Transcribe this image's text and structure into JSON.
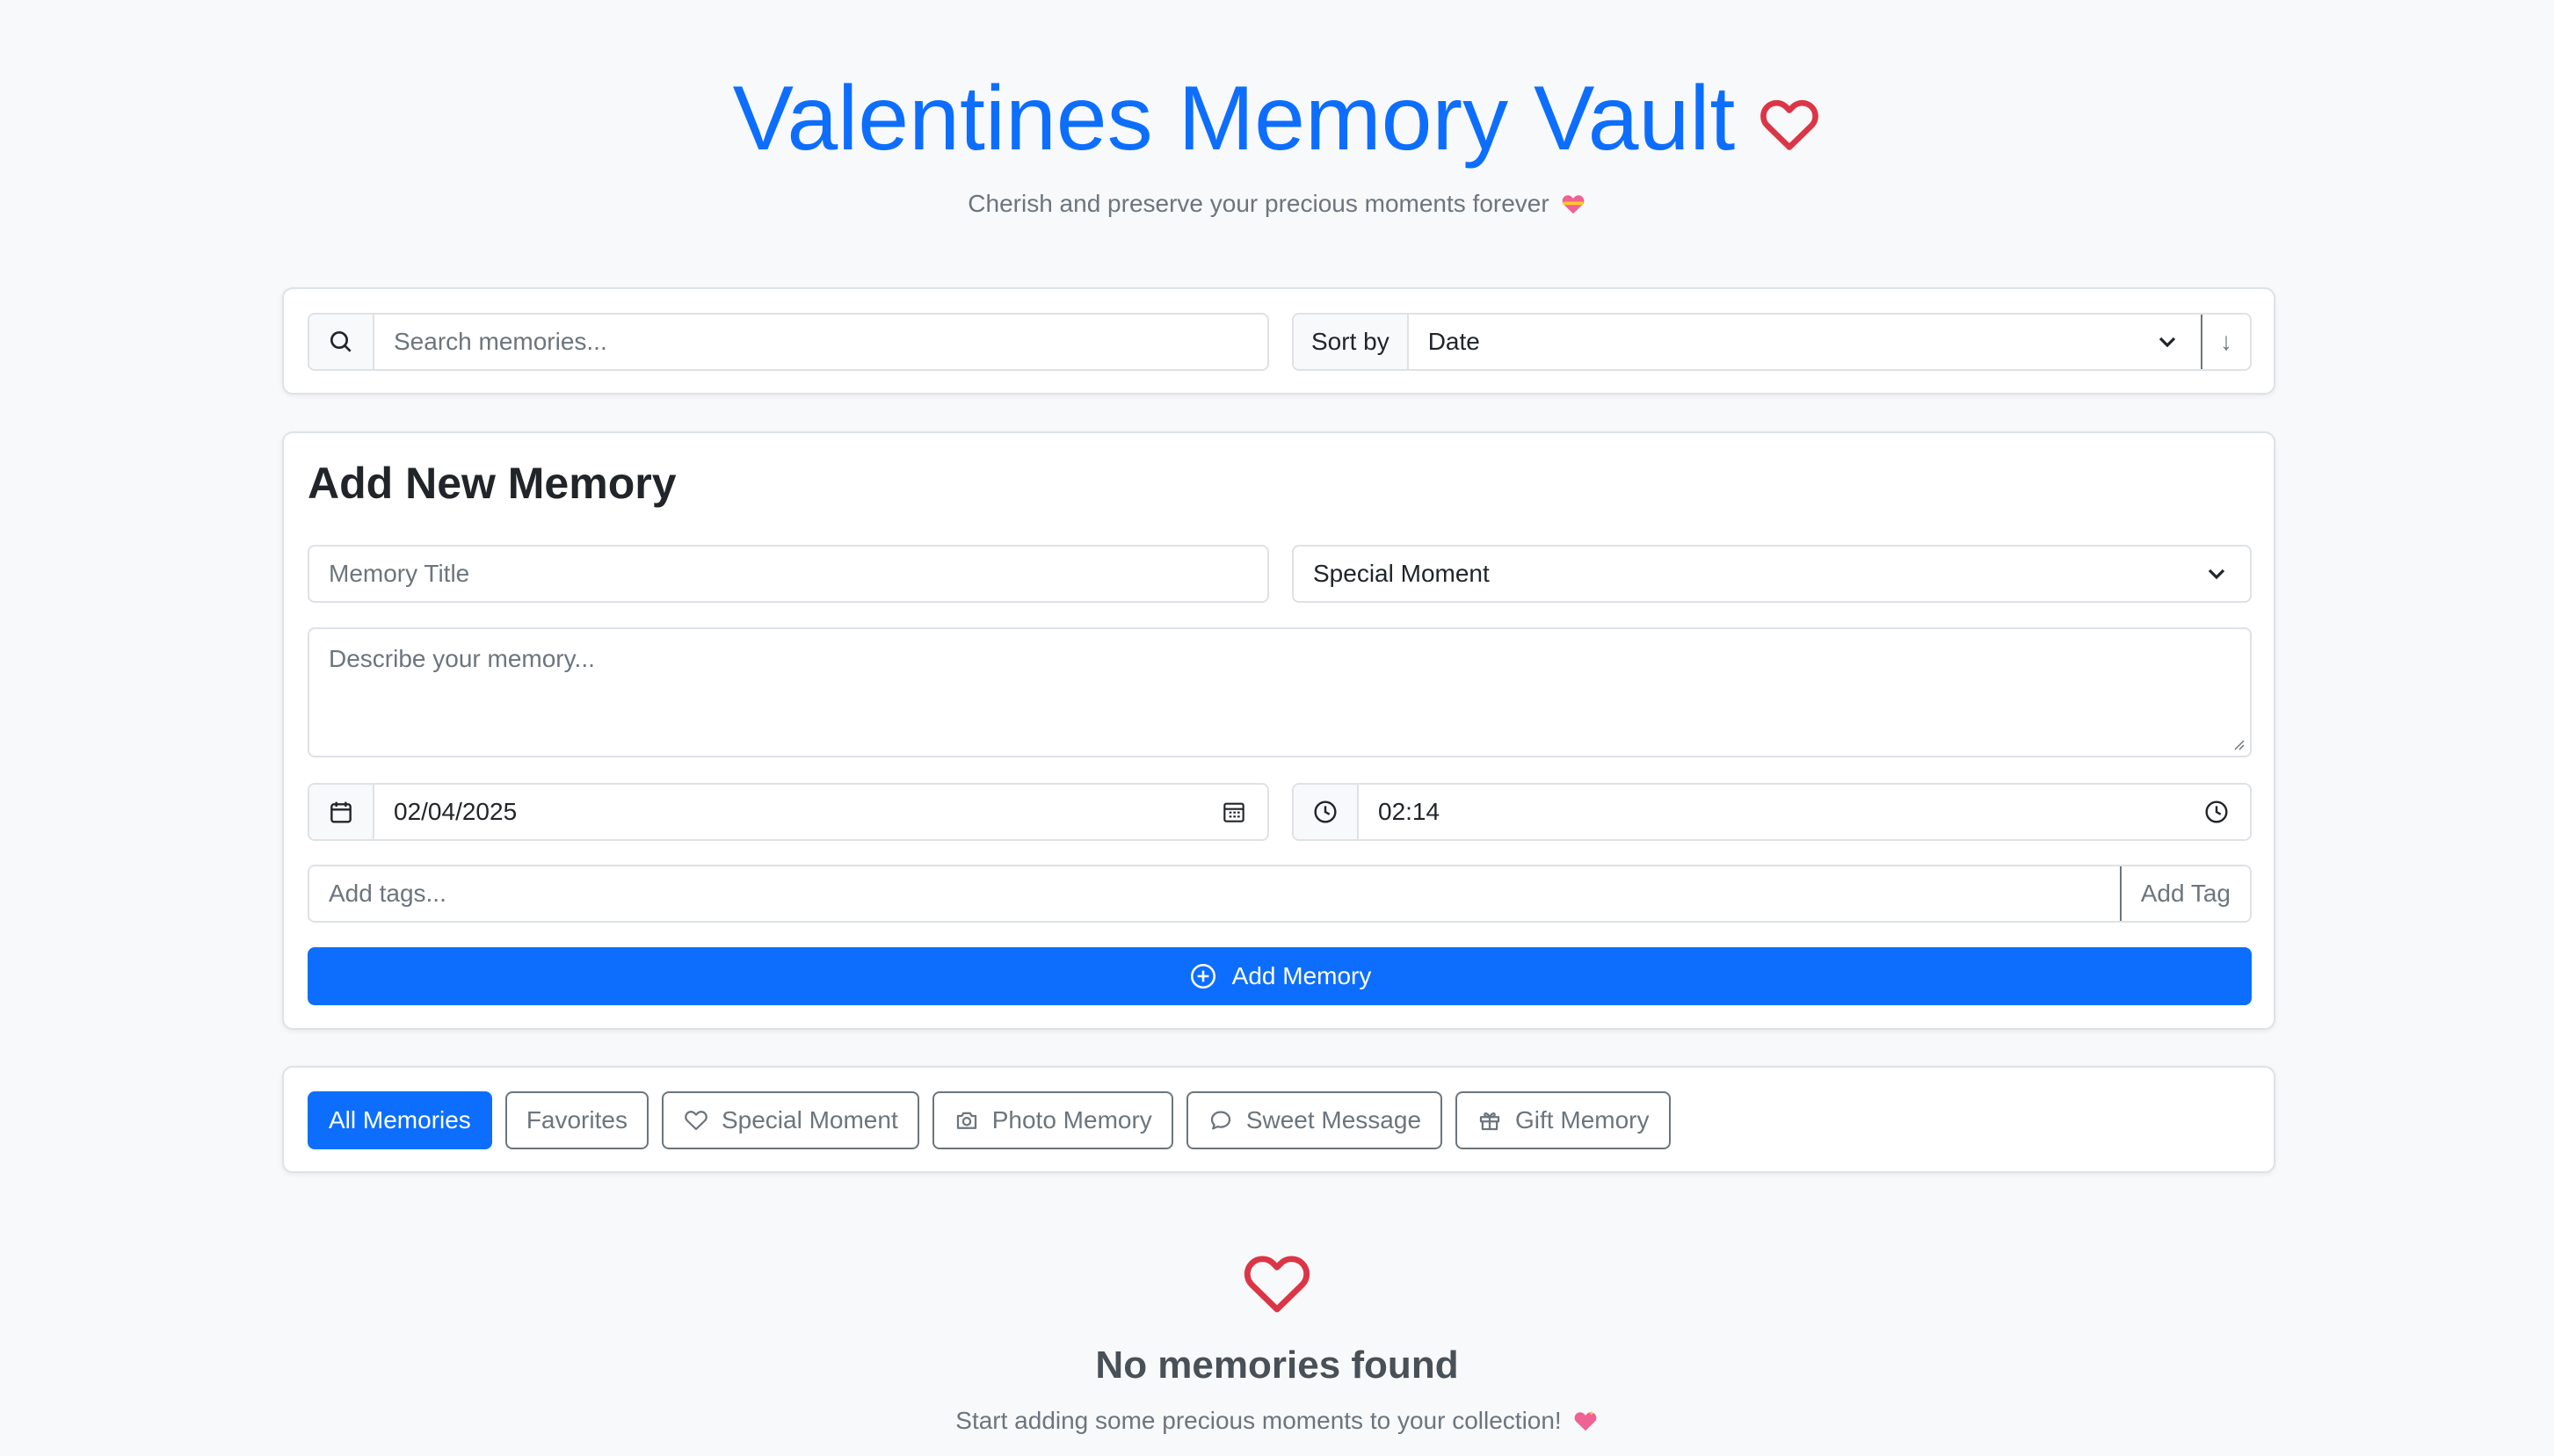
{
  "header": {
    "title": "Valentines Memory Vault",
    "subtitle": "Cherish and preserve your precious moments forever"
  },
  "toolbar": {
    "search_placeholder": "Search memories...",
    "sort_label": "Sort by",
    "sort_value": "Date",
    "sort_direction": "↓"
  },
  "form": {
    "heading": "Add New Memory",
    "title_placeholder": "Memory Title",
    "category_value": "Special Moment",
    "description_placeholder": "Describe your memory...",
    "date_value": "02/04/2025",
    "time_value": "02:14",
    "tags_placeholder": "Add tags...",
    "add_tag_label": "Add Tag",
    "submit_label": "Add Memory"
  },
  "filters": {
    "all": "All Memories",
    "favorites": "Favorites",
    "special": "Special Moment",
    "photo": "Photo Memory",
    "message": "Sweet Message",
    "gift": "Gift Memory"
  },
  "empty_state": {
    "title": "No memories found",
    "subtitle": "Start adding some precious moments to your collection!"
  },
  "colors": {
    "primary": "#0d6efd",
    "heart": "#dc3545",
    "emoji_pink": "#f06292",
    "background": "#f8f9fa"
  }
}
